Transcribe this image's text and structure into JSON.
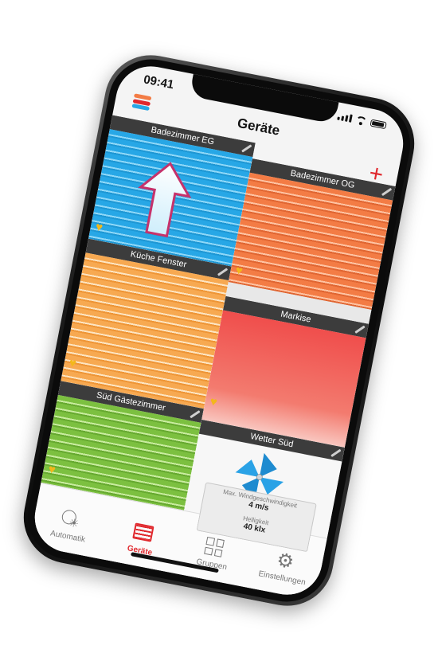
{
  "status": {
    "time": "09:41"
  },
  "nav": {
    "title": "Geräte",
    "add_label": "+"
  },
  "tiles": {
    "badezimmer_eg": {
      "title": "Badezimmer EG"
    },
    "badezimmer_og": {
      "title": "Badezimmer OG"
    },
    "kueche": {
      "title": "Küche Fenster"
    },
    "markise": {
      "title": "Markise"
    },
    "sued": {
      "title": "Süd Gästezimmer"
    },
    "wetter": {
      "title": "Wetter Süd",
      "wind_label": "Max. Windgeschwindigkeit",
      "wind_value": "4 m/s",
      "light_label": "Helligkeit",
      "light_value": "40 klx"
    }
  },
  "tabs": {
    "automatik": "Automatik",
    "geraete": "Geräte",
    "gruppen": "Gruppen",
    "einstellungen": "Einstellungen"
  },
  "colors": {
    "accent": "#e0282d",
    "blue": "#27a7e6",
    "orange": "#f37c45",
    "yellow": "#f7a951",
    "red": "#f04e4c",
    "green": "#7cc040",
    "heart": "#f3b71b"
  },
  "icons": {
    "logo": "stacked-bars-logo",
    "fav": "heart-icon",
    "edit": "pencil-icon"
  }
}
